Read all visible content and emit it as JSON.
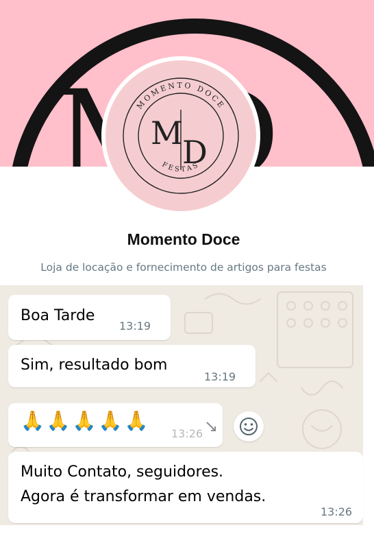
{
  "profile": {
    "name": "Momento Doce",
    "description": "Loja de locação e fornecimento de artigos para festas",
    "logo": {
      "arc_top": "MOMENTO DOCE",
      "arc_bottom": "FESTAS",
      "monogram_left": "M",
      "monogram_right": "D"
    },
    "cover_monogram": "MD"
  },
  "messages": [
    {
      "text": "Boa Tarde",
      "time": "13:19"
    },
    {
      "text": "Sim, resultado bom",
      "time": "13:19"
    },
    {
      "text": "🙏🙏🙏🙏🙏",
      "time": "13:26"
    },
    {
      "line1": "Muito Contato, seguidores.",
      "line2": "Agora é transformar em vendas.",
      "time": "13:26"
    }
  ],
  "colors": {
    "cover_pink": "#ffbfcb",
    "logo_pink": "#f5cdd0",
    "chat_background": "#efeae2",
    "bubble": "#ffffff",
    "meta_text": "#667781"
  },
  "icons": {
    "reaction": "emoji-smile-icon",
    "emoji": "folded-hands-icon"
  }
}
